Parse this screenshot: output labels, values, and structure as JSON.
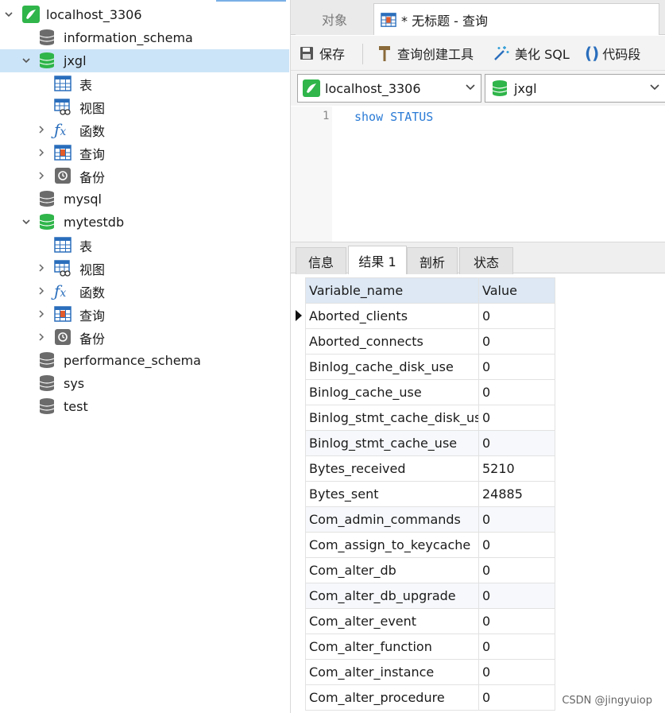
{
  "navigator": {
    "connection": "localhost_3306",
    "databases": {
      "information_schema": "information_schema",
      "jxgl": "jxgl",
      "mysql": "mysql",
      "mytestdb": "mytestdb",
      "performance_schema": "performance_schema",
      "sys": "sys",
      "test": "test"
    },
    "children": {
      "tables": "表",
      "views": "视图",
      "functions": "函数",
      "queries": "查询",
      "backups": "备份"
    }
  },
  "tabs": {
    "objects": "对象",
    "query": "* 无标题 - 查询"
  },
  "toolbar": {
    "save": "保存",
    "query_builder": "查询创建工具",
    "beautify": "美化 SQL",
    "snippet": "代码段"
  },
  "selectors": {
    "connection": "localhost_3306",
    "database": "jxgl"
  },
  "editor": {
    "line_number": "1",
    "code": "show STATUS"
  },
  "result_tabs": {
    "info": "信息",
    "result1": "结果 1",
    "profile": "剖析",
    "status": "状态"
  },
  "grid": {
    "columns": [
      "Variable_name",
      "Value"
    ],
    "rows": [
      [
        "Aborted_clients",
        "0"
      ],
      [
        "Aborted_connects",
        "0"
      ],
      [
        "Binlog_cache_disk_use",
        "0"
      ],
      [
        "Binlog_cache_use",
        "0"
      ],
      [
        "Binlog_stmt_cache_disk_use",
        "0"
      ],
      [
        "Binlog_stmt_cache_use",
        "0"
      ],
      [
        "Bytes_received",
        "5210"
      ],
      [
        "Bytes_sent",
        "24885"
      ],
      [
        "Com_admin_commands",
        "0"
      ],
      [
        "Com_assign_to_keycache",
        "0"
      ],
      [
        "Com_alter_db",
        "0"
      ],
      [
        "Com_alter_db_upgrade",
        "0"
      ],
      [
        "Com_alter_event",
        "0"
      ],
      [
        "Com_alter_function",
        "0"
      ],
      [
        "Com_alter_instance",
        "0"
      ],
      [
        "Com_alter_procedure",
        "0"
      ]
    ]
  },
  "watermark": "CSDN @jingyuiop",
  "colors": {
    "selection": "#cce4f7",
    "db_green": "#2fb54a",
    "keyword_blue": "#2b7bd6",
    "header_bg": "#dde8f4"
  }
}
